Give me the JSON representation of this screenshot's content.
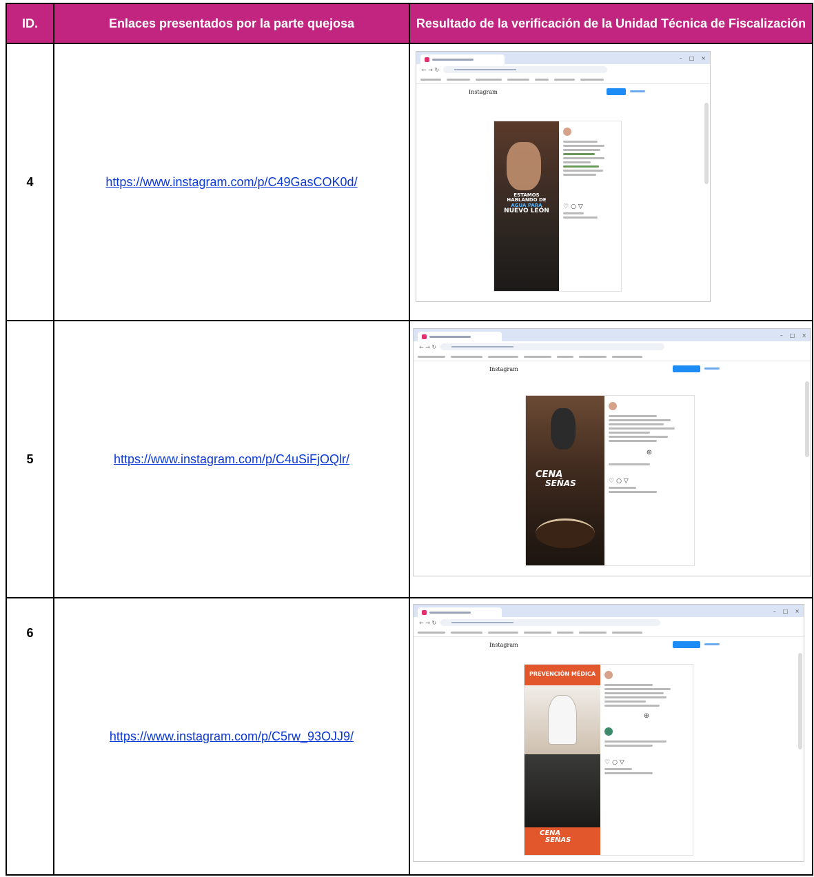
{
  "headers": {
    "id": "ID.",
    "links": "Enlaces presentados por la parte quejosa",
    "result": "Resultado de la verificación de la Unidad Técnica de Fiscalización"
  },
  "rows": [
    {
      "id": "4",
      "url": "https://www.instagram.com/p/C49GasCOK0d/",
      "shot": {
        "site_logo": "Instagram",
        "overlay_lines": [
          "ESTAMOS",
          "HABLANDO DE",
          "AGUA PARA",
          "NUEVO LEÓN"
        ]
      }
    },
    {
      "id": "5",
      "url": "https://www.instagram.com/p/C4uSiFjOQlr/",
      "shot": {
        "site_logo": "Instagram",
        "overlay_lines": [
          "CENA",
          "SEÑAS"
        ]
      }
    },
    {
      "id": "6",
      "url": "https://www.instagram.com/p/C5rw_93OJJ9/",
      "shot": {
        "site_logo": "Instagram",
        "overlay_lines": [
          "PREVENCIÓN MÉDICA",
          "CENA",
          "SEÑAS"
        ]
      }
    }
  ],
  "colors": {
    "header_bg": "#c2257f",
    "header_text": "#ffffff",
    "link": "#0b39d8"
  }
}
